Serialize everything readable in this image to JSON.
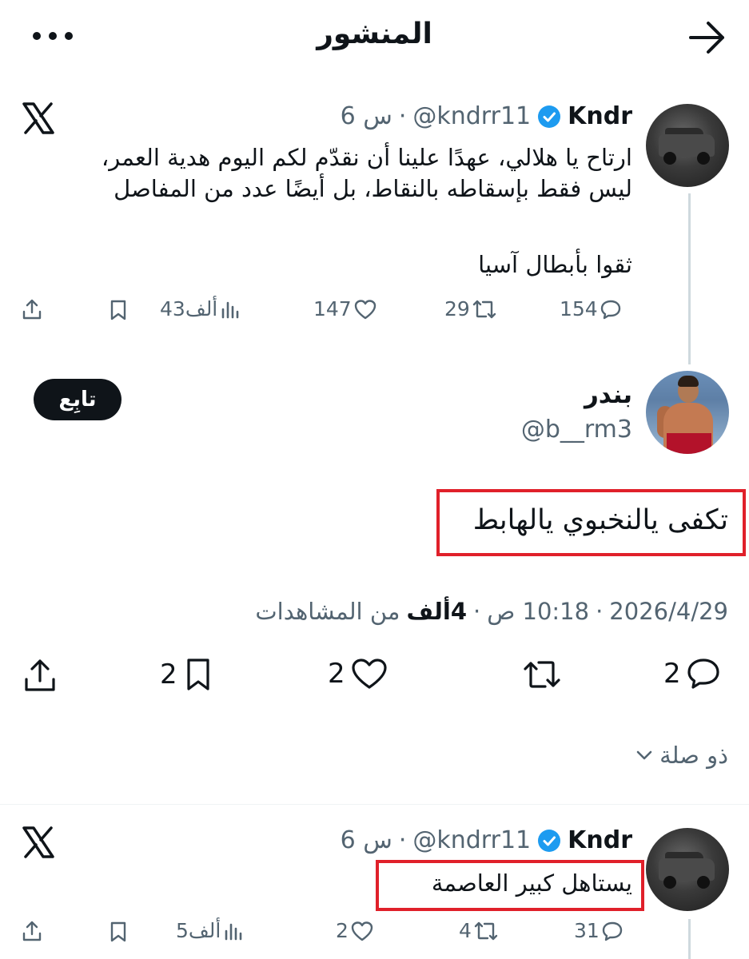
{
  "header": {
    "title": "المنشور",
    "back_icon": "arrow-right-icon",
    "more_icon": "more-horizontal-icon"
  },
  "quoted_post_1": {
    "author_name": "Kndr",
    "handle": "@kndrr11",
    "time": "6 س",
    "text_line1": "ارتاح يا هلالي، عهدًا علينا أن نقدّم لكم اليوم هدية العمر،",
    "text_line2": "ليس فقط بإسقاطه بالنقاط، بل أيضًا عدد من المفاصل",
    "text_line3": "ثقوا بأبطال آسيا",
    "replies": "154",
    "retweets": "29",
    "likes": "147",
    "views": "43ألف"
  },
  "main_post": {
    "author_name": "بندر",
    "handle": "@b__rm3",
    "follow_label": "تابِع",
    "text": "تكفى يالنخبوي يالهابط",
    "date": "2026/4/29",
    "time": "10:18 ص",
    "views_count": "4ألف",
    "views_label": "من المشاهدات",
    "replies": "2",
    "likes": "2",
    "bookmarks": "2"
  },
  "related": {
    "label": "ذو صلة"
  },
  "quoted_post_2": {
    "author_name": "Kndr",
    "handle": "@kndrr11",
    "time": "6 س",
    "text": "يستاهل كبير العاصمة",
    "replies": "31",
    "retweets": "4",
    "likes": "2",
    "views": "5ألف"
  },
  "colors": {
    "verified_blue": "#1d9bf0",
    "highlight_red": "#e0202a",
    "muted_text": "#536471"
  }
}
